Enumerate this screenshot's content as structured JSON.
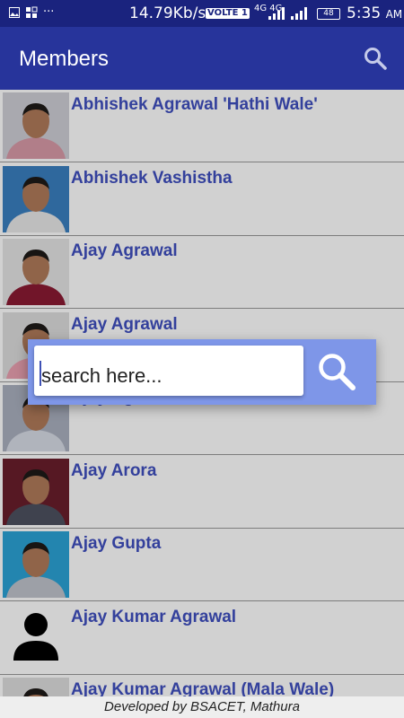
{
  "status_bar": {
    "speed": "14.79Kb/s",
    "volte": "VOLTE 1",
    "network": "4G 4G",
    "battery": "48",
    "time": "5:35",
    "ampm": "AM"
  },
  "app_bar": {
    "title": "Members",
    "search_icon": "search-icon"
  },
  "members": [
    {
      "name": "Abhishek Agrawal 'Hathi Wale'",
      "shirt": "#d89aa8",
      "bg": "#cfcfd6"
    },
    {
      "name": "Abhishek Vashistha",
      "shirt": "#e8e8e8",
      "bg": "#3a7fc0"
    },
    {
      "name": "Ajay Agrawal",
      "shirt": "#8a1a33",
      "bg": "#e4e4e4"
    },
    {
      "name": "Ajay Agrawal",
      "shirt": "#e9a0b0",
      "bg": "#ddd"
    },
    {
      "name": "Ajay Agrawal",
      "shirt": "#d7dce6",
      "bg": "#aab0bf"
    },
    {
      "name": "Ajay Arora",
      "shirt": "#4e5160",
      "bg": "#6a1e2b"
    },
    {
      "name": "Ajay Gupta",
      "shirt": "#c0c4cc",
      "bg": "#2ba3d6"
    },
    {
      "name": "Ajay Kumar Agrawal",
      "shirt": "",
      "bg": ""
    },
    {
      "name": "Ajay Kumar Agrawal (Mala Wale)",
      "shirt": "#ccc",
      "bg": "#ddd"
    }
  ],
  "search_dialog": {
    "placeholder": "search here...",
    "button_icon": "search-icon"
  },
  "footer": {
    "text": "Developed by BSACET, Mathura"
  },
  "colors": {
    "primary": "#27349b",
    "primary_dark": "#1a237e",
    "accent": "#7e96e8",
    "member_name": "#3f4fbf"
  }
}
